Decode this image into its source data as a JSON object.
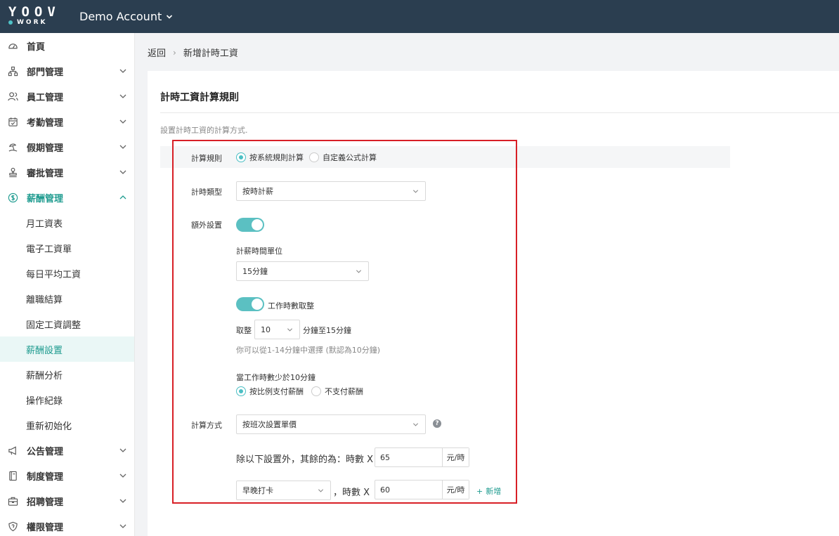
{
  "brand": {
    "logo_main": "YOOV",
    "logo_sub": "WORK",
    "accent": "#4bbfc4"
  },
  "account": {
    "name": "Demo Account"
  },
  "sidebar": {
    "items": [
      {
        "label": "首頁",
        "icon": "dashboard-icon",
        "has_arrow": false
      },
      {
        "label": "部門管理",
        "icon": "org-chart-icon",
        "has_arrow": true
      },
      {
        "label": "員工管理",
        "icon": "users-icon",
        "has_arrow": true
      },
      {
        "label": "考勤管理",
        "icon": "calendar-check-icon",
        "has_arrow": true
      },
      {
        "label": "假期管理",
        "icon": "vacation-icon",
        "has_arrow": true
      },
      {
        "label": "審批管理",
        "icon": "stamp-icon",
        "has_arrow": true
      },
      {
        "label": "薪酬管理",
        "icon": "dollar-icon",
        "has_arrow": true,
        "expanded": true
      }
    ],
    "subitems": [
      {
        "label": "月工資表"
      },
      {
        "label": "電子工資單"
      },
      {
        "label": "每日平均工資"
      },
      {
        "label": "離職結算"
      },
      {
        "label": "固定工資調整"
      },
      {
        "label": "薪酬設置",
        "active": true
      },
      {
        "label": "薪酬分析"
      },
      {
        "label": "操作紀錄"
      },
      {
        "label": "重新初始化"
      }
    ],
    "items_after": [
      {
        "label": "公告管理",
        "icon": "megaphone-icon",
        "has_arrow": true
      },
      {
        "label": "制度管理",
        "icon": "book-icon",
        "has_arrow": true
      },
      {
        "label": "招聘管理",
        "icon": "briefcase-icon",
        "has_arrow": true
      },
      {
        "label": "權限管理",
        "icon": "shield-icon",
        "has_arrow": true
      }
    ]
  },
  "breadcrumb": {
    "back": "返回",
    "separator": "›",
    "current": "新增計時工資"
  },
  "section": {
    "title": "計時工資計算規則",
    "description": "設置計時工資的計算方式."
  },
  "form": {
    "calc_rule": {
      "label": "計算規則",
      "options": [
        "按系統規則計算",
        "自定義公式計算"
      ],
      "selected": 0
    },
    "hourly_type": {
      "label": "計時類型",
      "value": "按時計薪"
    },
    "extra_settings": {
      "label": "額外設置",
      "enabled": true,
      "time_unit_label": "計薪時間單位",
      "time_unit_value": "15分鐘",
      "rounding_toggle_label": "工作時數取整",
      "rounding_enabled": true,
      "rounding_prefix": "取整",
      "rounding_value": "10",
      "rounding_suffix": "分鐘至15分鐘",
      "rounding_hint": "你可以從1-14分鐘中選擇 (默認為10分鐘)",
      "under_label": "當工作時數少於10分鐘",
      "under_options": [
        "按比例支付薪酬",
        "不支付薪酬"
      ],
      "under_selected": 0
    },
    "calc_method": {
      "label": "計算方式",
      "value": "按班次設置單價",
      "help": "?",
      "rest_text": "除以下設置外，其餘的為：時數 X",
      "rest_value": "65",
      "unit": "元/時",
      "shift_value": "早晚打卡",
      "shift_text": "，時數 X",
      "shift_rate": "60",
      "add_label": "新增",
      "add_symbol": "+"
    }
  }
}
